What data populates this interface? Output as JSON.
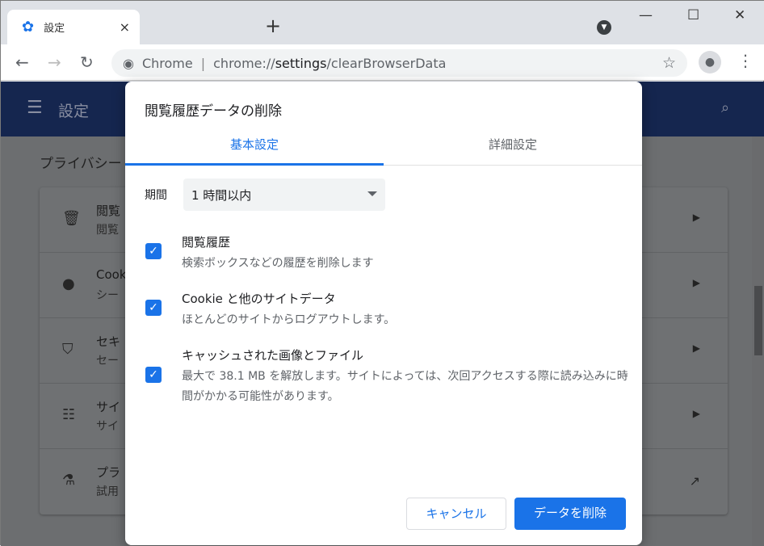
{
  "tab": {
    "title": "設定",
    "close": "×"
  },
  "new_tab": "+",
  "window_controls": {
    "minimize": "—",
    "maximize": "☐",
    "close": "✕"
  },
  "omnibox": {
    "site": "Chrome",
    "url_host": "chrome://",
    "url_path": "settings",
    "url_rest": "/clearBrowserData"
  },
  "page": {
    "header_title": "設定",
    "section": "プライバシー",
    "rows": [
      {
        "t1": "閲覧",
        "t2": "閲覧"
      },
      {
        "t1": "Cook",
        "t2": "シー"
      },
      {
        "t1": "セキ",
        "t2": "セー"
      },
      {
        "t1": "サイ",
        "t2": "サイ"
      },
      {
        "t1": "プラ",
        "t2": "試用"
      }
    ]
  },
  "dialog": {
    "title": "閲覧履歴データの削除",
    "tabs": [
      {
        "label": "基本設定",
        "active": true
      },
      {
        "label": "詳細設定",
        "active": false
      }
    ],
    "period_label": "期間",
    "period_value": "1 時間以内",
    "options": [
      {
        "title": "閲覧履歴",
        "desc": "検索ボックスなどの履歴を削除します",
        "checked": true
      },
      {
        "title": "Cookie と他のサイトデータ",
        "desc": "ほとんどのサイトからログアウトします。",
        "checked": true
      },
      {
        "title": "キャッシュされた画像とファイル",
        "desc": "最大で 38.1 MB を解放します。サイトによっては、次回アクセスする際に読み込みに時間がかかる可能性があります。",
        "checked": true
      }
    ],
    "cancel": "キャンセル",
    "delete": "データを削除"
  },
  "colors": {
    "accent": "#1a73e8",
    "header": "#15264f"
  }
}
